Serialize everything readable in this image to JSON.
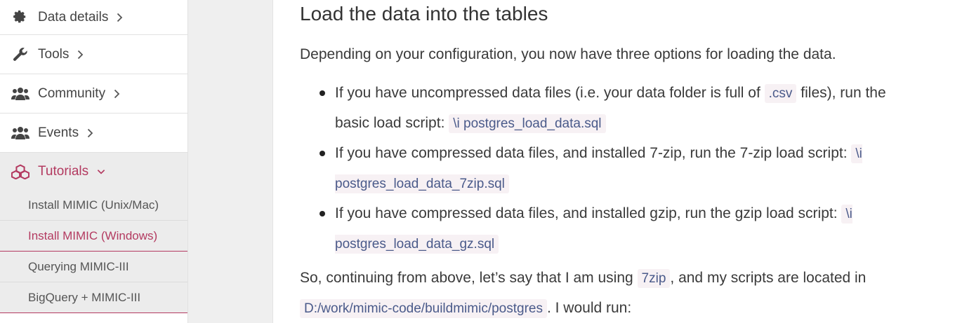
{
  "sidebar": {
    "items": [
      {
        "label": "Data details",
        "icon": "gear-icon"
      },
      {
        "label": "Tools",
        "icon": "wrench-icon"
      },
      {
        "label": "Community",
        "icon": "users-icon"
      },
      {
        "label": "Events",
        "icon": "users-icon"
      },
      {
        "label": "Tutorials",
        "icon": "cubes-icon"
      }
    ],
    "sub_items": [
      {
        "label": "Install MIMIC (Unix/Mac)"
      },
      {
        "label": "Install MIMIC (Windows)"
      },
      {
        "label": "Querying MIMIC-III"
      },
      {
        "label": "BigQuery + MIMIC-III"
      }
    ]
  },
  "content": {
    "heading": "Load the data into the tables",
    "intro": "Depending on your configuration, you now have three options for loading the data.",
    "options": [
      {
        "text_1": "If you have uncompressed data files (i.e. your data folder is full of ",
        "code_1": ".csv",
        "text_2": " files), run the basic load script: ",
        "code_2": "\\i postgres_load_data.sql"
      },
      {
        "text_1": "If you have compressed data files, and installed 7-zip, run the 7-zip load script: ",
        "code_1": "\\i postgres_load_data_7zip.sql"
      },
      {
        "text_1": "If you have compressed data files, and installed gzip, run the gzip load script: ",
        "code_1": "\\i postgres_load_data_gz.sql"
      }
    ],
    "closing": {
      "text_1": "So, continuing from above, let’s say that I am using ",
      "code_1": "7zip",
      "text_2": ", and my scripts are located in ",
      "code_2": "D:/work/mimic-code/buildmimic/postgres",
      "text_3": ". I would run:"
    }
  },
  "colors": {
    "accent": "#b33a60",
    "code_bg": "#f7f1f4",
    "code_text": "#4a5a8a"
  }
}
